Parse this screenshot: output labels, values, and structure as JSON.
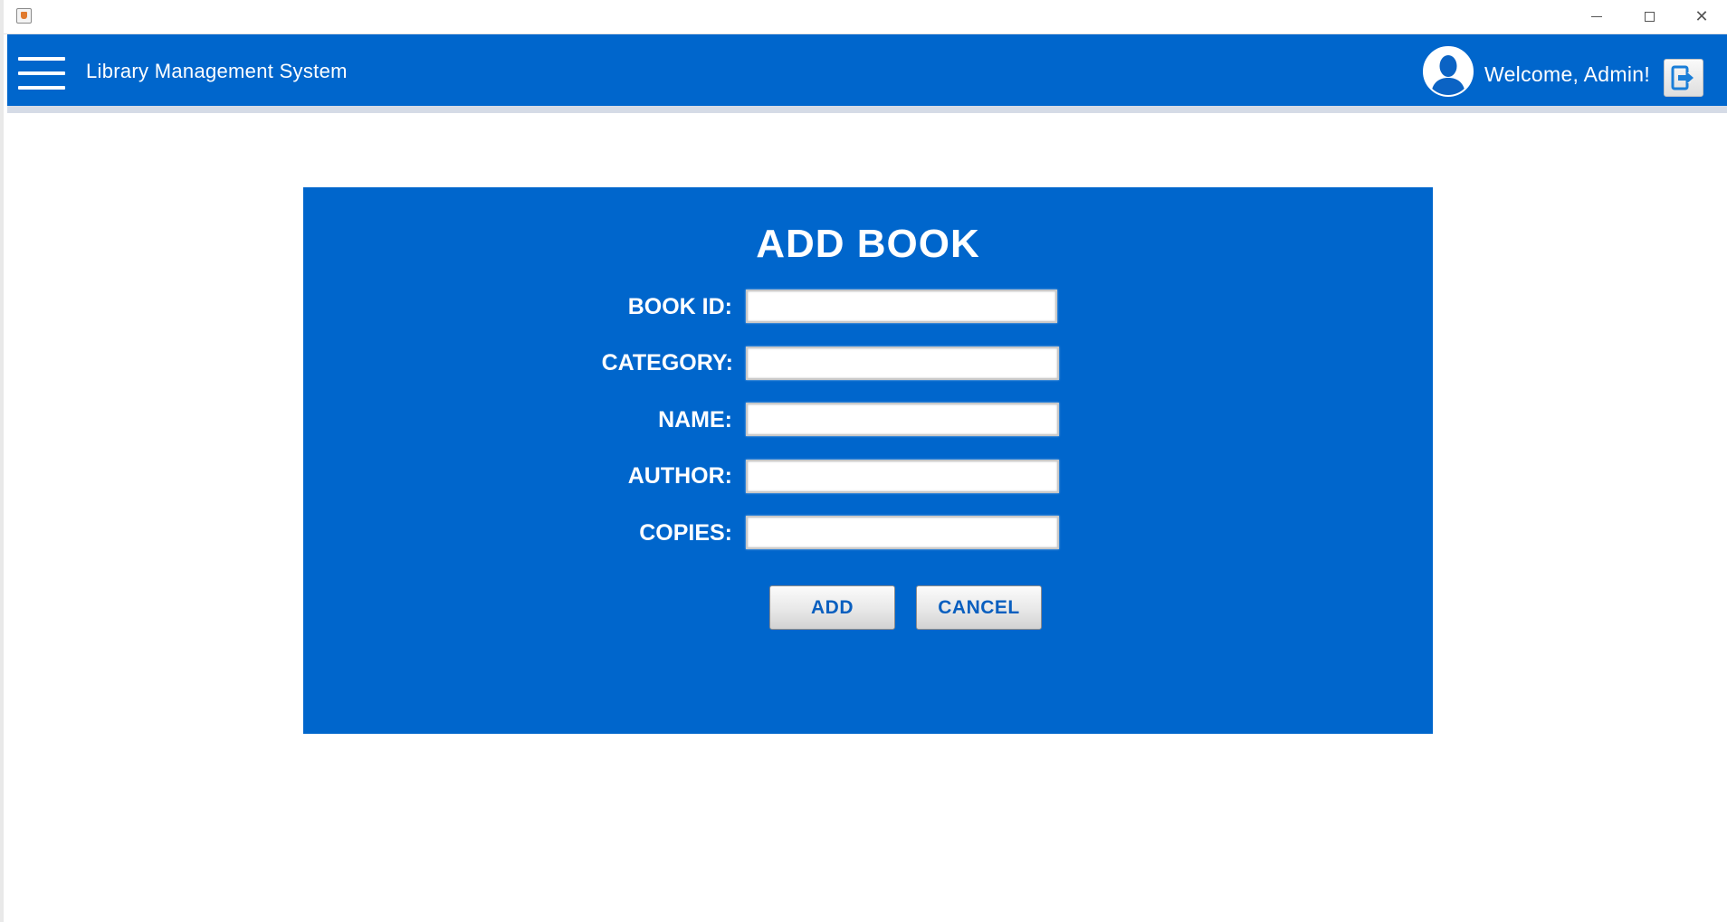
{
  "window": {
    "icon": "java-app-icon",
    "controls": {
      "minimize_icon": "minimize-icon",
      "maximize_icon": "maximize-icon",
      "close_icon": "close-icon",
      "close_glyph": "✕"
    }
  },
  "header": {
    "menu_icon": "hamburger-menu-icon",
    "title": "Library Management System",
    "avatar_icon": "user-avatar-icon",
    "welcome": "Welcome, Admin!",
    "logout_icon": "logout-icon",
    "background_color": "#0066cc"
  },
  "form": {
    "title": "ADD BOOK",
    "background_color": "#0066cc",
    "fields": [
      {
        "label": "BOOK ID:",
        "value": "",
        "placeholder": ""
      },
      {
        "label": "CATEGORY:",
        "value": "",
        "placeholder": ""
      },
      {
        "label": "NAME:",
        "value": "",
        "placeholder": ""
      },
      {
        "label": "AUTHOR:",
        "value": "",
        "placeholder": ""
      },
      {
        "label": "COPIES:",
        "value": "",
        "placeholder": ""
      }
    ],
    "add_label": "ADD",
    "cancel_label": "CANCEL"
  }
}
